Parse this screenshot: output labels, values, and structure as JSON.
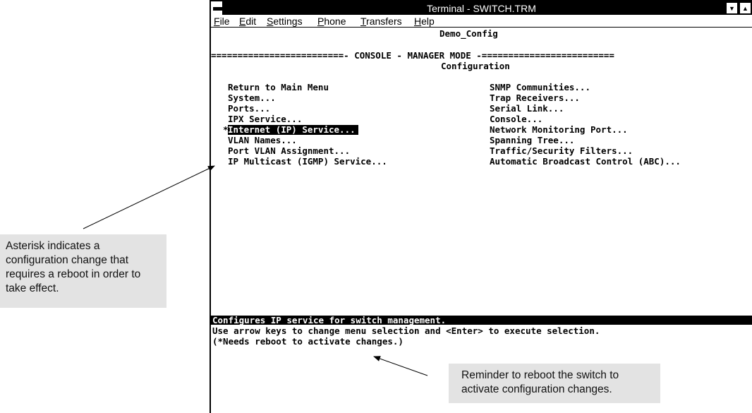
{
  "window": {
    "title": "Terminal - SWITCH.TRM",
    "menu": [
      {
        "label": "File",
        "hotkey": "F",
        "rest": "ile"
      },
      {
        "label": "Edit",
        "hotkey": "E",
        "rest": "dit"
      },
      {
        "label": "Settings",
        "hotkey": "S",
        "rest": "ettings"
      },
      {
        "label": "Phone",
        "hotkey": "P",
        "rest": "hone"
      },
      {
        "label": "Transfers",
        "hotkey": "T",
        "rest": "ransfers"
      },
      {
        "label": "Help",
        "hotkey": "H",
        "rest": "elp"
      }
    ]
  },
  "screen": {
    "config_name": "Demo_Config",
    "mode_line": "=========================- CONSOLE - MANAGER MODE -=========================",
    "section_title": "Configuration",
    "left_menu": [
      "Return to Main Menu",
      "System...",
      "Ports...",
      "IPX Service...",
      "Internet (IP) Service...",
      "VLAN Names...",
      "Port VLAN Assignment...",
      "IP Multicast (IGMP) Service..."
    ],
    "selected_marker": "*",
    "right_menu": [
      "SNMP Communities...",
      "Trap Receivers...",
      "Serial Link...",
      "Console...",
      "Network Monitoring Port...",
      "Spanning Tree...",
      "Traffic/Security Filters...",
      "Automatic Broadcast Control (ABC)..."
    ],
    "status": "Configures IP service for switch management.",
    "help_line": "Use arrow keys to change menu selection and <Enter> to execute selection.",
    "reboot_note": "(*Needs reboot to activate changes.)"
  },
  "callouts": {
    "asterisk": "Asterisk indicates a configuration change that requires a reboot in order to take effect.",
    "reboot": "Reminder to reboot the switch to activate configuration changes."
  }
}
